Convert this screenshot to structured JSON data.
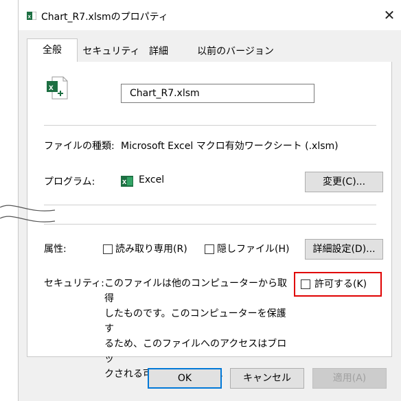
{
  "window": {
    "title": "Chart_R7.xlsmのプロパティ",
    "close_icon": "close-icon",
    "title_icon": "excel-file-icon"
  },
  "tabs": [
    {
      "label": "全般",
      "active": true
    },
    {
      "label": "セキュリティ",
      "active": false
    },
    {
      "label": "詳細",
      "active": false
    },
    {
      "label": "以前のバージョン",
      "active": false
    }
  ],
  "general": {
    "file_icon": "excel-macro-file-icon",
    "filename": "Chart_R7.xlsm",
    "type_label": "ファイルの種類:",
    "type_value": "Microsoft Excel マクロ有効ワークシート (.xlsm)",
    "program_label": "プログラム:",
    "program_icon": "excel-app-icon",
    "program_value": "Excel",
    "change_button": "変更(C)...",
    "attributes_label": "属性:",
    "readonly_label": "読み取り専用(R)",
    "readonly_checked": false,
    "hidden_label": "隠しファイル(H)",
    "hidden_checked": false,
    "advanced_button": "詳細設定(D)...",
    "security_label": "セキュリティ:",
    "security_text_lines": [
      "このファイルは他のコンピューターから取得",
      "したものです。このコンピューターを保護す",
      "るため、このファイルへのアクセスはブロッ",
      "クされる可能性があります。"
    ],
    "unblock_label": "許可する(K)",
    "unblock_checked": false,
    "highlight_color": "#e00000"
  },
  "footer": {
    "ok": "OK",
    "cancel": "キャンセル",
    "apply": "適用(A)"
  }
}
